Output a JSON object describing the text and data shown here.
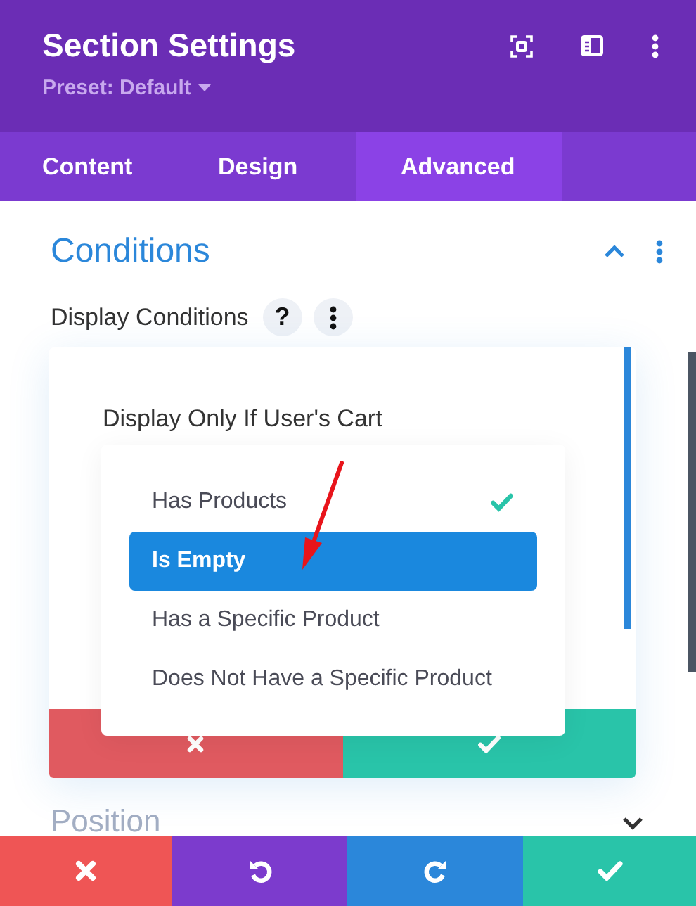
{
  "header": {
    "title": "Section Settings",
    "preset": "Preset: Default"
  },
  "tabs": [
    {
      "label": "Content",
      "selected": false
    },
    {
      "label": "Design",
      "selected": false
    },
    {
      "label": "Advanced",
      "selected": true
    }
  ],
  "section": {
    "title": "Conditions",
    "expanded": true
  },
  "field": {
    "label": "Display Conditions",
    "help": "?"
  },
  "condition": {
    "label": "Display Only If User's Cart",
    "options": [
      {
        "label": "Has Products",
        "checked": true,
        "selected": false
      },
      {
        "label": "Is Empty",
        "checked": false,
        "selected": true
      },
      {
        "label": "Has a Specific Product",
        "checked": false,
        "selected": false
      },
      {
        "label": "Does Not Have a Specific Product",
        "checked": false,
        "selected": false
      }
    ]
  },
  "next_section": {
    "title": "Position",
    "expanded": false
  },
  "footer": [
    {
      "kind": "discard"
    },
    {
      "kind": "undo"
    },
    {
      "kind": "redo"
    },
    {
      "kind": "save"
    }
  ]
}
